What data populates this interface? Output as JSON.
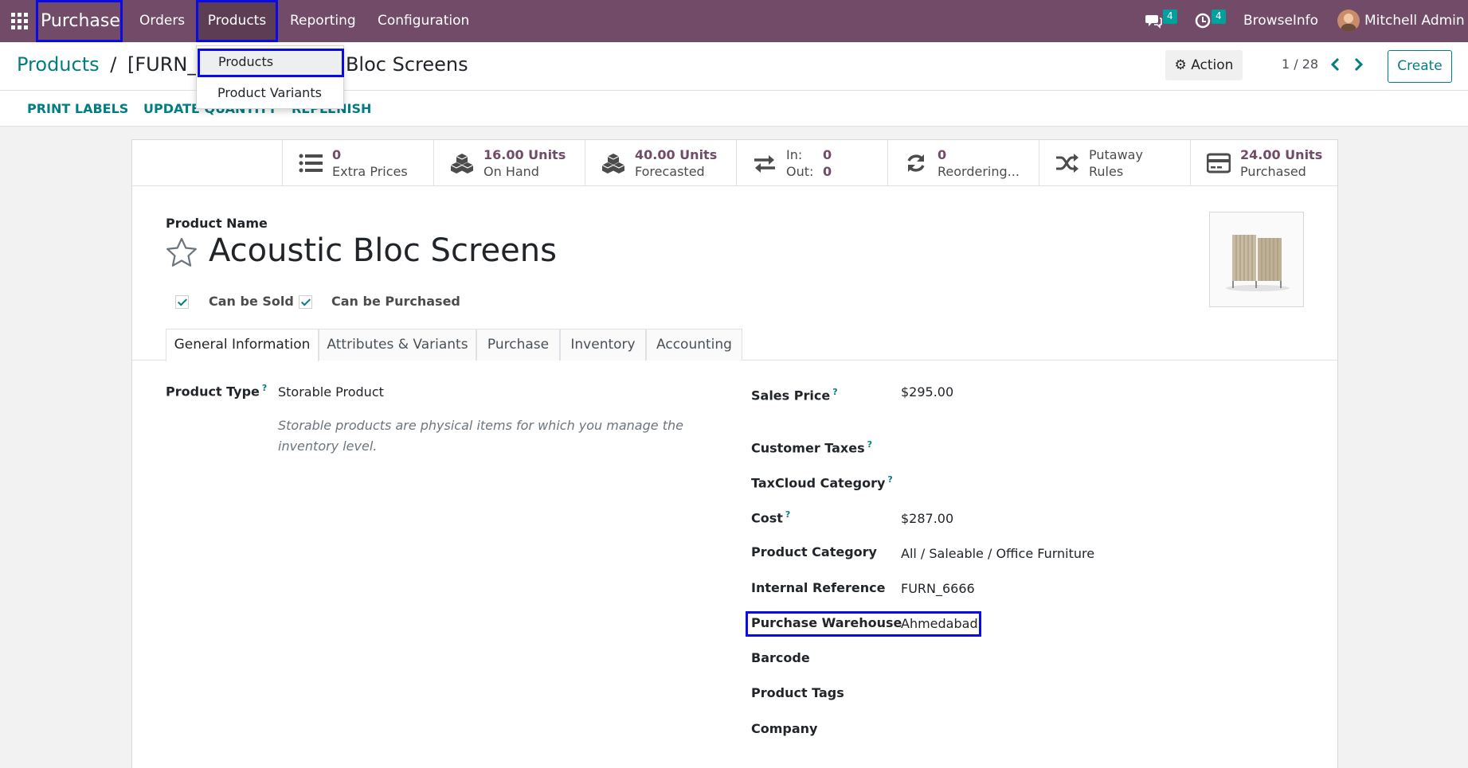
{
  "navbar": {
    "app_name": "Purchase",
    "menu": [
      "Orders",
      "Products",
      "Reporting",
      "Configuration"
    ],
    "messages_count": "4",
    "activities_count": "4",
    "company": "BrowseInfo",
    "user": "Mitchell Admin",
    "bg_color": "#714b67"
  },
  "dropdown": {
    "items": [
      "Products",
      "Product Variants"
    ]
  },
  "breadcrumb": {
    "parent": "Products",
    "separator": "/",
    "current": "[FURN_6666] Acoustic Bloc Screens"
  },
  "control": {
    "action_label": "Action",
    "pager": "1 / 28",
    "create_label": "Create"
  },
  "header_buttons": [
    "PRINT LABELS",
    "UPDATE QUANTITY",
    "REPLENISH"
  ],
  "smart_buttons": {
    "extra_prices": {
      "value": "0",
      "label": "Extra Prices"
    },
    "on_hand": {
      "value": "16.00 Units",
      "label": "On Hand"
    },
    "forecasted": {
      "value": "40.00 Units",
      "label": "Forecasted"
    },
    "in_out": {
      "in_label": "In:",
      "in_value": "0",
      "out_label": "Out:",
      "out_value": "0"
    },
    "reordering": {
      "value": "0",
      "label": "Reordering..."
    },
    "putaway": {
      "line1": "Putaway",
      "line2": "Rules"
    },
    "purchased": {
      "value": "24.00 Units",
      "label": "Purchased"
    }
  },
  "product": {
    "name_label": "Product Name",
    "name": "Acoustic Bloc Screens",
    "can_be_sold": "Can be Sold",
    "can_be_purchased": "Can be Purchased"
  },
  "tabs": [
    "General Information",
    "Attributes & Variants",
    "Purchase",
    "Inventory",
    "Accounting"
  ],
  "fields": {
    "product_type_label": "Product Type",
    "product_type": "Storable Product",
    "product_type_help": "Storable products are physical items for which you manage the inventory level.",
    "sales_price_label": "Sales Price",
    "sales_price": "$295.00",
    "customer_taxes_label": "Customer Taxes",
    "taxcloud_label": "TaxCloud Category",
    "cost_label": "Cost",
    "cost": "$287.00",
    "category_label": "Product Category",
    "category": "All / Saleable / Office Furniture",
    "internal_ref_label": "Internal Reference",
    "internal_ref": "FURN_6666",
    "warehouse_label": "Purchase Warehouse",
    "warehouse": "Ahmedabad",
    "barcode_label": "Barcode",
    "tags_label": "Product Tags",
    "company_label": "Company",
    "help_marker": "?"
  }
}
